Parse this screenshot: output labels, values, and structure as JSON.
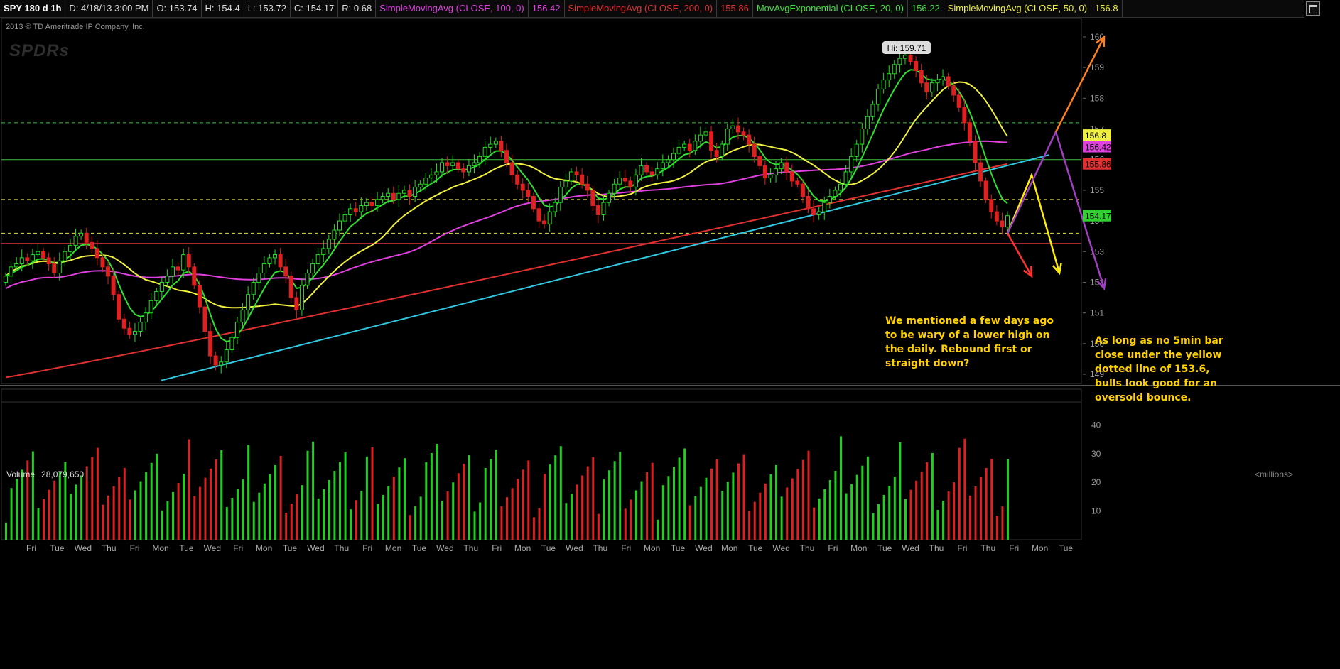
{
  "header": {
    "symbol": "SPY 180 d 1h",
    "date": "D: 4/18/13 3:00 PM",
    "open": "O: 153.74",
    "high": "H: 154.4",
    "low": "L: 153.72",
    "close": "C: 154.17",
    "range": "R: 0.68",
    "studies": [
      {
        "label": "SimpleMovingAvg (CLOSE, 100, 0)",
        "value": "156.42",
        "color": "#e040e0"
      },
      {
        "label": "SimpleMovingAvg (CLOSE, 200, 0)",
        "value": "155.86",
        "color": "#e03030"
      },
      {
        "label": "MovAvgExponential (CLOSE, 20, 0)",
        "value": "156.22",
        "color": "#40e040"
      },
      {
        "label": "SimpleMovingAvg (CLOSE, 50, 0)",
        "value": "156.8",
        "color": "#f0f040"
      }
    ]
  },
  "copyright": "2013 © TD Ameritrade IP Company, Inc.",
  "logo": "SPDRs",
  "annotations": {
    "note1": "We mentioned a few days ago\nto be wary of a lower high on\nthe daily. Rebound first or\nstraight down?",
    "note2": "As long as no 5min bar\nclose under the yellow\ndotted line of 153.6,\nbulls look good for an\noversold bounce."
  },
  "volume_panel": {
    "label": "Volume",
    "value": "28,079,650",
    "units": "<millions>"
  },
  "chart_data": [
    {
      "type": "candlestick",
      "ylim": [
        148.7,
        160.6
      ],
      "y_ticks": [
        149,
        150,
        151,
        152,
        153,
        154,
        155,
        156,
        157,
        158,
        159,
        160
      ],
      "x_labels": [
        "Fri",
        "Tue",
        "Wed",
        "Thu",
        "Fri",
        "Mon",
        "Tue",
        "Wed",
        "Fri",
        "Mon",
        "Tue",
        "Wed",
        "Thu",
        "Fri",
        "Mon",
        "Tue",
        "Wed",
        "Thu",
        "Fri",
        "Mon",
        "Tue",
        "Wed",
        "Thu",
        "Fri",
        "Mon",
        "Tue",
        "Wed",
        "Mon",
        "Tue",
        "Wed",
        "Thu",
        "Fri",
        "Mon",
        "Tue",
        "Wed",
        "Thu",
        "Fri",
        "Thu",
        "Fri",
        "Mon",
        "Tue"
      ],
      "high_label": "Hi: 159.71",
      "last_price": 154.17,
      "price_tags": [
        {
          "value": 156.8,
          "label": "156.8",
          "color": "#f0f040"
        },
        {
          "value": 156.42,
          "label": "156.42",
          "color": "#e040e0"
        },
        {
          "value": 155.86,
          "label": "155.86",
          "color": "#e03030"
        },
        {
          "value": 154.17,
          "label": "154.17",
          "color": "#30d030"
        }
      ],
      "horizontal_levels": [
        {
          "value": 157.2,
          "style": "dashed",
          "color": "#40c040"
        },
        {
          "value": 156.0,
          "style": "solid",
          "color": "#40c040"
        },
        {
          "value": 154.7,
          "style": "dashed",
          "color": "#e0e040"
        },
        {
          "value": 153.6,
          "style": "dashed",
          "color": "#e0e040"
        },
        {
          "value": 153.27,
          "style": "solid",
          "color": "#c03030"
        }
      ],
      "trendline": {
        "from": [
          0.148,
          148.8
        ],
        "to": [
          0.97,
          156.15
        ],
        "color": "#30c8e0"
      },
      "closes": [
        152.2,
        152.5,
        152.6,
        152.8,
        152.7,
        152.9,
        153.0,
        152.8,
        152.6,
        152.3,
        152.7,
        153.0,
        153.2,
        153.5,
        153.6,
        153.3,
        153.1,
        152.8,
        152.5,
        152.2,
        151.6,
        150.8,
        150.5,
        150.3,
        150.4,
        150.7,
        151.0,
        151.4,
        151.7,
        152.0,
        152.2,
        152.5,
        152.4,
        152.9,
        152.5,
        151.9,
        151.2,
        150.4,
        149.6,
        149.3,
        149.4,
        149.8,
        150.2,
        150.7,
        151.1,
        151.6,
        152.0,
        152.3,
        152.6,
        152.8,
        152.9,
        152.5,
        152.2,
        151.5,
        151.1,
        151.9,
        152.3,
        152.6,
        152.9,
        153.1,
        153.4,
        153.7,
        154.0,
        154.2,
        154.4,
        154.3,
        154.5,
        154.6,
        154.5,
        154.7,
        154.8,
        154.9,
        154.7,
        154.9,
        155.0,
        154.8,
        155.1,
        155.2,
        155.4,
        155.5,
        155.6,
        155.9,
        155.8,
        155.9,
        155.7,
        155.6,
        155.8,
        155.9,
        156.1,
        156.4,
        156.5,
        156.6,
        156.3,
        155.9,
        155.5,
        155.2,
        155.0,
        154.8,
        154.4,
        154.0,
        153.9,
        154.3,
        154.6,
        155.1,
        155.3,
        155.6,
        155.5,
        155.2,
        155.0,
        154.5,
        154.2,
        154.6,
        154.9,
        155.2,
        155.4,
        155.3,
        155.1,
        155.5,
        155.8,
        155.6,
        155.5,
        155.7,
        155.9,
        156.0,
        156.2,
        156.4,
        156.5,
        156.3,
        156.6,
        156.8,
        156.9,
        156.3,
        156.1,
        156.5,
        157.0,
        157.1,
        156.9,
        156.8,
        156.5,
        156.1,
        155.8,
        155.4,
        155.5,
        155.7,
        155.9,
        155.6,
        155.3,
        155.2,
        154.8,
        154.4,
        154.2,
        154.3,
        154.6,
        154.8,
        155.0,
        155.2,
        155.6,
        156.1,
        156.5,
        157.0,
        157.4,
        157.8,
        158.3,
        158.6,
        158.8,
        159.1,
        159.3,
        159.4,
        159.2,
        158.9,
        158.5,
        158.2,
        158.5,
        158.6,
        158.7,
        158.4,
        158.1,
        157.7,
        157.2,
        156.6,
        155.9,
        155.3,
        154.7,
        154.3,
        154.0,
        153.8,
        154.17
      ],
      "ema20": {
        "color": "#30e030"
      },
      "sma50": {
        "color": "#f0f040"
      },
      "sma100": {
        "color": "#e040e0"
      },
      "sma200": {
        "color": "#e03030"
      },
      "projections": [
        {
          "color": "#ff3030",
          "path": [
            [
              153.6,
              0
            ],
            [
              152.2,
              20
            ]
          ]
        },
        {
          "color": "#ffee00",
          "path": [
            [
              153.6,
              0
            ],
            [
              155.5,
              20
            ],
            [
              152.3,
              43
            ]
          ]
        },
        {
          "color": "#a040c0",
          "path": [
            [
              153.6,
              0
            ],
            [
              156.9,
              40
            ],
            [
              151.8,
              80
            ]
          ]
        },
        {
          "color": "#ff8020",
          "path": [
            [
              156.9,
              40
            ],
            [
              160.0,
              80
            ]
          ]
        }
      ]
    },
    {
      "type": "bar",
      "title": "Volume",
      "ylim": [
        0,
        48
      ],
      "y_ticks": [
        10,
        20,
        30,
        40
      ],
      "units": "millions",
      "current": 28.08
    }
  ]
}
